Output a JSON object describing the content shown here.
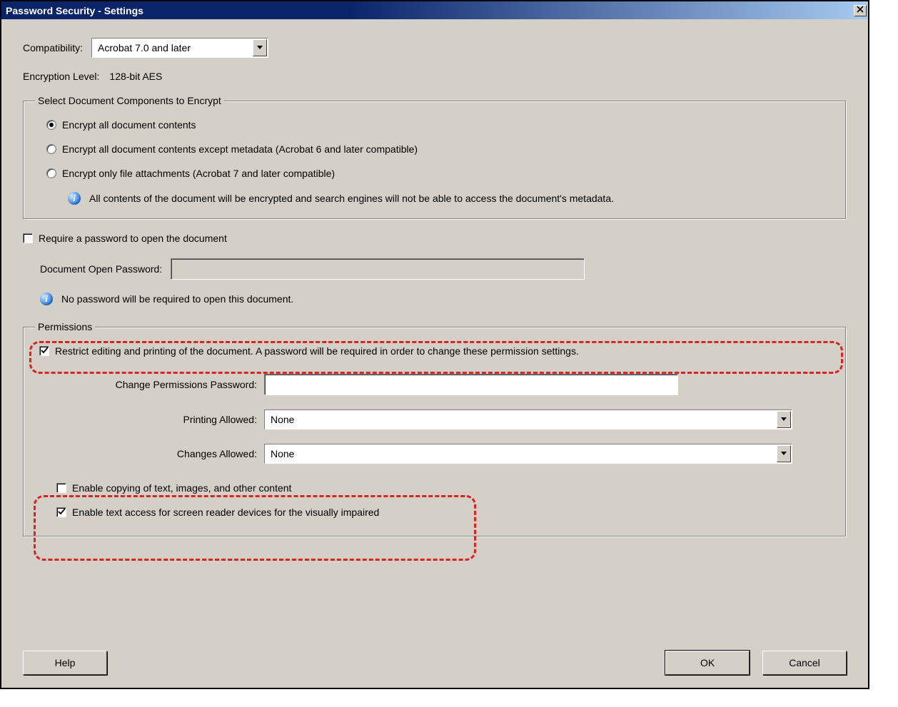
{
  "title": "Password Security - Settings",
  "compatibility": {
    "label": "Compatibility:",
    "value": "Acrobat 7.0 and later"
  },
  "encryption": {
    "label": "Encryption  Level:",
    "value": "128-bit AES"
  },
  "encrypt_group": {
    "legend": "Select Document Components to Encrypt",
    "option1": "Encrypt all document contents",
    "option2": "Encrypt all document contents except metadata (Acrobat 6 and later compatible)",
    "option3": "Encrypt only file attachments (Acrobat 7 and later compatible)",
    "info": "All contents of the document will be encrypted and search engines will not be able to access the document's metadata."
  },
  "require_open": {
    "label": "Require a password to open the document",
    "password_label": "Document Open Password:",
    "info": "No password will be required to open this document."
  },
  "permissions": {
    "legend": "Permissions",
    "restrict": "Restrict editing and printing of the document. A password will be required in order to change these permission settings.",
    "change_pw_label": "Change Permissions Password:",
    "printing_label": "Printing Allowed:",
    "printing_value": "None",
    "changes_label": "Changes Allowed:",
    "changes_value": "None",
    "enable_copy": "Enable copying of text, images, and other content",
    "enable_access": "Enable text access for screen reader devices for the visually impaired"
  },
  "buttons": {
    "help": "Help",
    "ok": "OK",
    "cancel": "Cancel"
  }
}
